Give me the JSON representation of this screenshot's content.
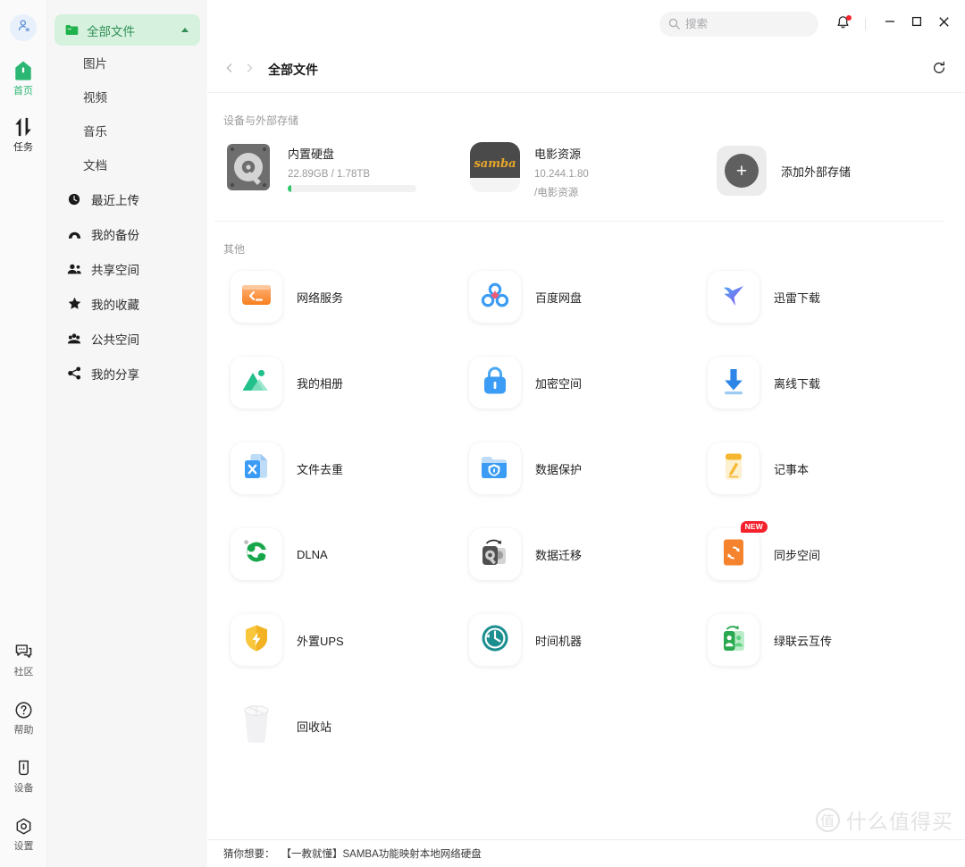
{
  "rail": {
    "avatar_icon": "user-avatar-icon",
    "items": [
      {
        "icon": "home-icon",
        "label": "首页",
        "active": true
      },
      {
        "icon": "task-transfer-icon",
        "label": "任务",
        "active": false
      }
    ],
    "bottom_items": [
      {
        "icon": "community-chat-icon",
        "label": "社区"
      },
      {
        "icon": "help-question-icon",
        "label": "帮助"
      },
      {
        "icon": "device-icon",
        "label": "设备"
      },
      {
        "icon": "settings-gear-icon",
        "label": "设置"
      }
    ]
  },
  "sidebar": {
    "header": {
      "label": "全部文件",
      "icon": "folder-icon",
      "caret": "chevron-up-icon"
    },
    "sub_items": [
      {
        "label": "图片"
      },
      {
        "label": "视频"
      },
      {
        "label": "音乐"
      },
      {
        "label": "文档"
      }
    ],
    "items": [
      {
        "label": "最近上传",
        "icon": "clock-icon"
      },
      {
        "label": "我的备份",
        "icon": "cloud-backup-icon"
      },
      {
        "label": "共享空间",
        "icon": "people-icon"
      },
      {
        "label": "我的收藏",
        "icon": "star-icon"
      },
      {
        "label": "公共空间",
        "icon": "group-icon"
      },
      {
        "label": "我的分享",
        "icon": "share-icon"
      }
    ]
  },
  "titlebar": {
    "search": {
      "placeholder": "搜索",
      "value": "",
      "icon": "search-icon"
    },
    "bell": {
      "icon": "bell-icon",
      "has_unread": true
    },
    "minimize": "minimize-icon",
    "maximize": "maximize-icon",
    "close": "close-icon"
  },
  "breadcrumb": {
    "back": "chevron-left-icon",
    "forward": "chevron-right-icon",
    "title": "全部文件",
    "refresh": "refresh-icon"
  },
  "storage": {
    "section_label": "设备与外部存储",
    "items": [
      {
        "icon": "internal-hard-disk-icon",
        "name": "内置硬盘",
        "meta": "22.89GB / 1.78TB",
        "usage_percent": 3,
        "path": ""
      },
      {
        "icon": "samba-icon",
        "name": "电影资源",
        "meta": "10.244.1.80",
        "path": "/电影资源"
      }
    ],
    "add": {
      "label": "添加外部存储",
      "icon": "plus-icon",
      "plus": "+"
    }
  },
  "others": {
    "section_label": "其他",
    "apps": [
      {
        "name": "网络服务",
        "icon": "terminal-icon",
        "badge": ""
      },
      {
        "name": "百度网盘",
        "icon": "baidu-netdisk-icon",
        "badge": ""
      },
      {
        "name": "迅雷下载",
        "icon": "thunder-hummingbird-icon",
        "badge": ""
      },
      {
        "name": "我的相册",
        "icon": "photo-album-icon",
        "badge": ""
      },
      {
        "name": "加密空间",
        "icon": "lock-icon",
        "badge": ""
      },
      {
        "name": "离线下载",
        "icon": "download-arrow-icon",
        "badge": ""
      },
      {
        "name": "文件去重",
        "icon": "file-dedupe-icon",
        "badge": ""
      },
      {
        "name": "数据保护",
        "icon": "shield-folder-icon",
        "badge": ""
      },
      {
        "name": "记事本",
        "icon": "notepad-pencil-icon",
        "badge": ""
      },
      {
        "name": "DLNA",
        "icon": "dlna-icon",
        "badge": ""
      },
      {
        "name": "数据迁移",
        "icon": "data-migration-icon",
        "badge": ""
      },
      {
        "name": "同步空间",
        "icon": "sync-folder-icon",
        "badge": "NEW"
      },
      {
        "name": "外置UPS",
        "icon": "ups-shield-bolt-icon",
        "badge": ""
      },
      {
        "name": "时间机器",
        "icon": "time-machine-clock-icon",
        "badge": ""
      },
      {
        "name": "绿联云互传",
        "icon": "ugreen-transfer-icon",
        "badge": ""
      },
      {
        "name": "回收站",
        "icon": "recycle-bin-icon",
        "badge": ""
      }
    ]
  },
  "footer": {
    "key": "猜你想要：",
    "value": "【一教就懂】SAMBA功能映射本地网络硬盘"
  },
  "watermark": {
    "mark": "值",
    "text": "什么值得买"
  },
  "colors": {
    "accent_green": "#2bb673",
    "sidebar_active_bg": "#d6f2de",
    "sidebar_active_text": "#2f8f55",
    "badge_red": "#f5222d",
    "progress_green": "#2ec76a"
  }
}
